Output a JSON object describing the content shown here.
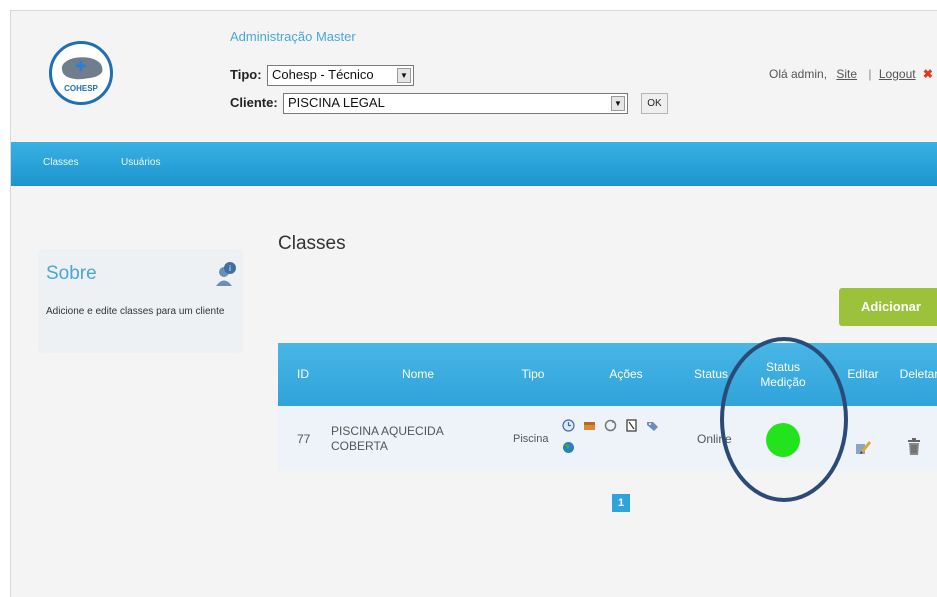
{
  "header": {
    "logo_text": "COHESP",
    "admin_title": "Administração Master",
    "tipo_label": "Tipo:",
    "tipo_value": "Cohesp - Técnico",
    "cliente_label": "Cliente:",
    "cliente_value": "PISCINA LEGAL",
    "ok_label": "OK",
    "greeting": "Olá admin,",
    "site_link": "Site",
    "separator": "|",
    "logout_link": "Logout",
    "logout_mark": "✖"
  },
  "nav": {
    "items": [
      {
        "label": "Classes"
      },
      {
        "label": "Usuários"
      }
    ]
  },
  "sidebar": {
    "title": "Sobre",
    "text": "Adicione e edite classes para um cliente"
  },
  "main": {
    "title": "Classes",
    "add_button": "Adicionar",
    "table": {
      "headers": [
        "ID",
        "Nome",
        "Tipo",
        "Ações",
        "Status",
        "Status Medição",
        "Editar",
        "Deletar"
      ],
      "rows": [
        {
          "id": "77",
          "nome": "PISCINA AQUECIDA COBERTA",
          "tipo": "Piscina",
          "acoes": [
            "clock-icon",
            "box-icon",
            "refresh-icon",
            "document-icon",
            "tag-icon",
            "globe-icon"
          ],
          "status": "Online",
          "status_medicao_color": "#22e31c",
          "editar_icon": "edit-pencil-icon",
          "deletar_icon": "trash-icon"
        }
      ]
    },
    "pagination": {
      "current_page": "1"
    }
  },
  "colors": {
    "brand_blue": "#2fa3da",
    "accent_green": "#9cc23c",
    "status_green": "#22e31c",
    "highlight_ring": "#2b4a78"
  }
}
